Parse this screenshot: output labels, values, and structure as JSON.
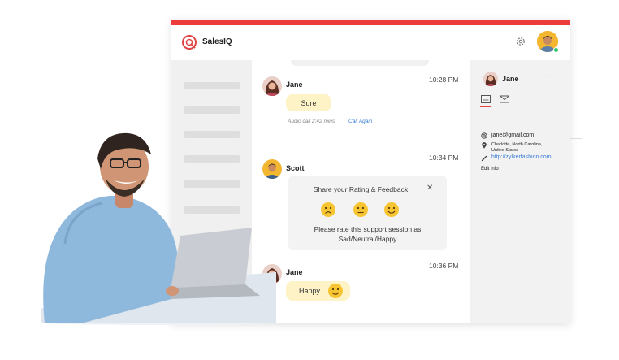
{
  "app": {
    "name": "SalesIQ"
  },
  "colors": {
    "accent": "#ec3c3c",
    "bubble": "#fdf3c7",
    "link": "#3a7bd5",
    "online": "#2ec46a"
  },
  "messages": [
    {
      "name": "Jane",
      "time": "10:28 PM",
      "text": "Sure",
      "call_note": "Audio call 2:42 mins",
      "call_action": "Call Again"
    },
    {
      "name": "Scott",
      "time": "10:34 PM"
    },
    {
      "name": "Jane",
      "time": "10:36 PM",
      "text": "Happy"
    }
  ],
  "feedback": {
    "title": "Share your Rating & Feedback",
    "close": "✕",
    "options": [
      "sad-face-icon",
      "neutral-face-icon",
      "happy-face-icon"
    ],
    "line1": "Please rate this support session as",
    "line2": "Sad/Neutral/Happy"
  },
  "contact": {
    "name": "Jane",
    "more": "···",
    "email": "jane@gmail.com",
    "location_line1": "Charlotte, North Carolina,",
    "location_line2": "United States",
    "website": "http://zylkerfashion.com",
    "edit": "Edit info"
  }
}
